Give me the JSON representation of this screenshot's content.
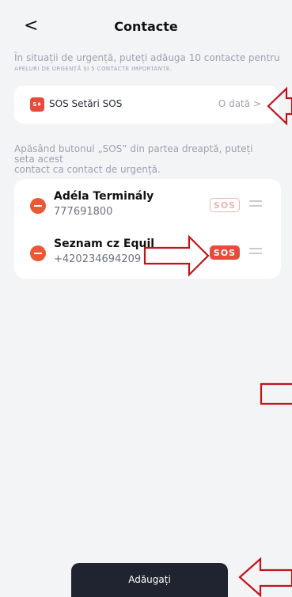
{
  "header": {
    "back_icon": "<",
    "title": "Contacte"
  },
  "intro": {
    "line1": "În situații de urgență, puteți adăuga 10 contacte pentru",
    "line2": "apeluri de urgență și 5 contacte importante."
  },
  "sos_settings": {
    "icon_text": "S♦",
    "label": "SOS Setări SOS",
    "frequency": "O dată >"
  },
  "instructions": {
    "line1": "Apăsând butonul „SOS” din partea dreaptă, puteți",
    "line2": "seta acest",
    "line3": "contact ca contact de urgență."
  },
  "contacts": [
    {
      "name": "Adéla Terminály",
      "phone": "777691800",
      "sos_label": "SOS",
      "sos_active": false
    },
    {
      "name": "Seznam cz Equil",
      "phone": "+420234694209",
      "sos_label": "SOS",
      "sos_active": true
    }
  ],
  "add_button": {
    "label": "Adăugați"
  },
  "colors": {
    "accent": "#e84a3c",
    "annotation": "#c0141c",
    "button_dark": "#1f2430"
  }
}
